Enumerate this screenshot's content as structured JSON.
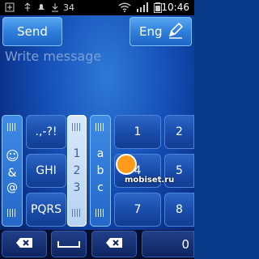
{
  "statusbar": {
    "time": "10:46",
    "notification": "34"
  },
  "compose": {
    "send_label": "Send",
    "language_label": "Eng",
    "placeholder": "Write message"
  },
  "keypad": {
    "left_mode_keys": [
      "☺",
      "&",
      "@"
    ],
    "left_letter_keys": [
      ".,-?!",
      "GHI",
      "PQRS"
    ],
    "mode_numbers": [
      "1",
      "2",
      "3"
    ],
    "mode_letters": [
      "a",
      "b",
      "c"
    ],
    "number_keys_col1": [
      "1",
      "4",
      "7"
    ],
    "number_keys_col2": [
      "2",
      "5",
      "8"
    ],
    "bottom_zero": "0"
  },
  "watermark": "mobiset.ru",
  "colors": {
    "accent": "#2f7fdc",
    "background": "#0a3a8a"
  }
}
